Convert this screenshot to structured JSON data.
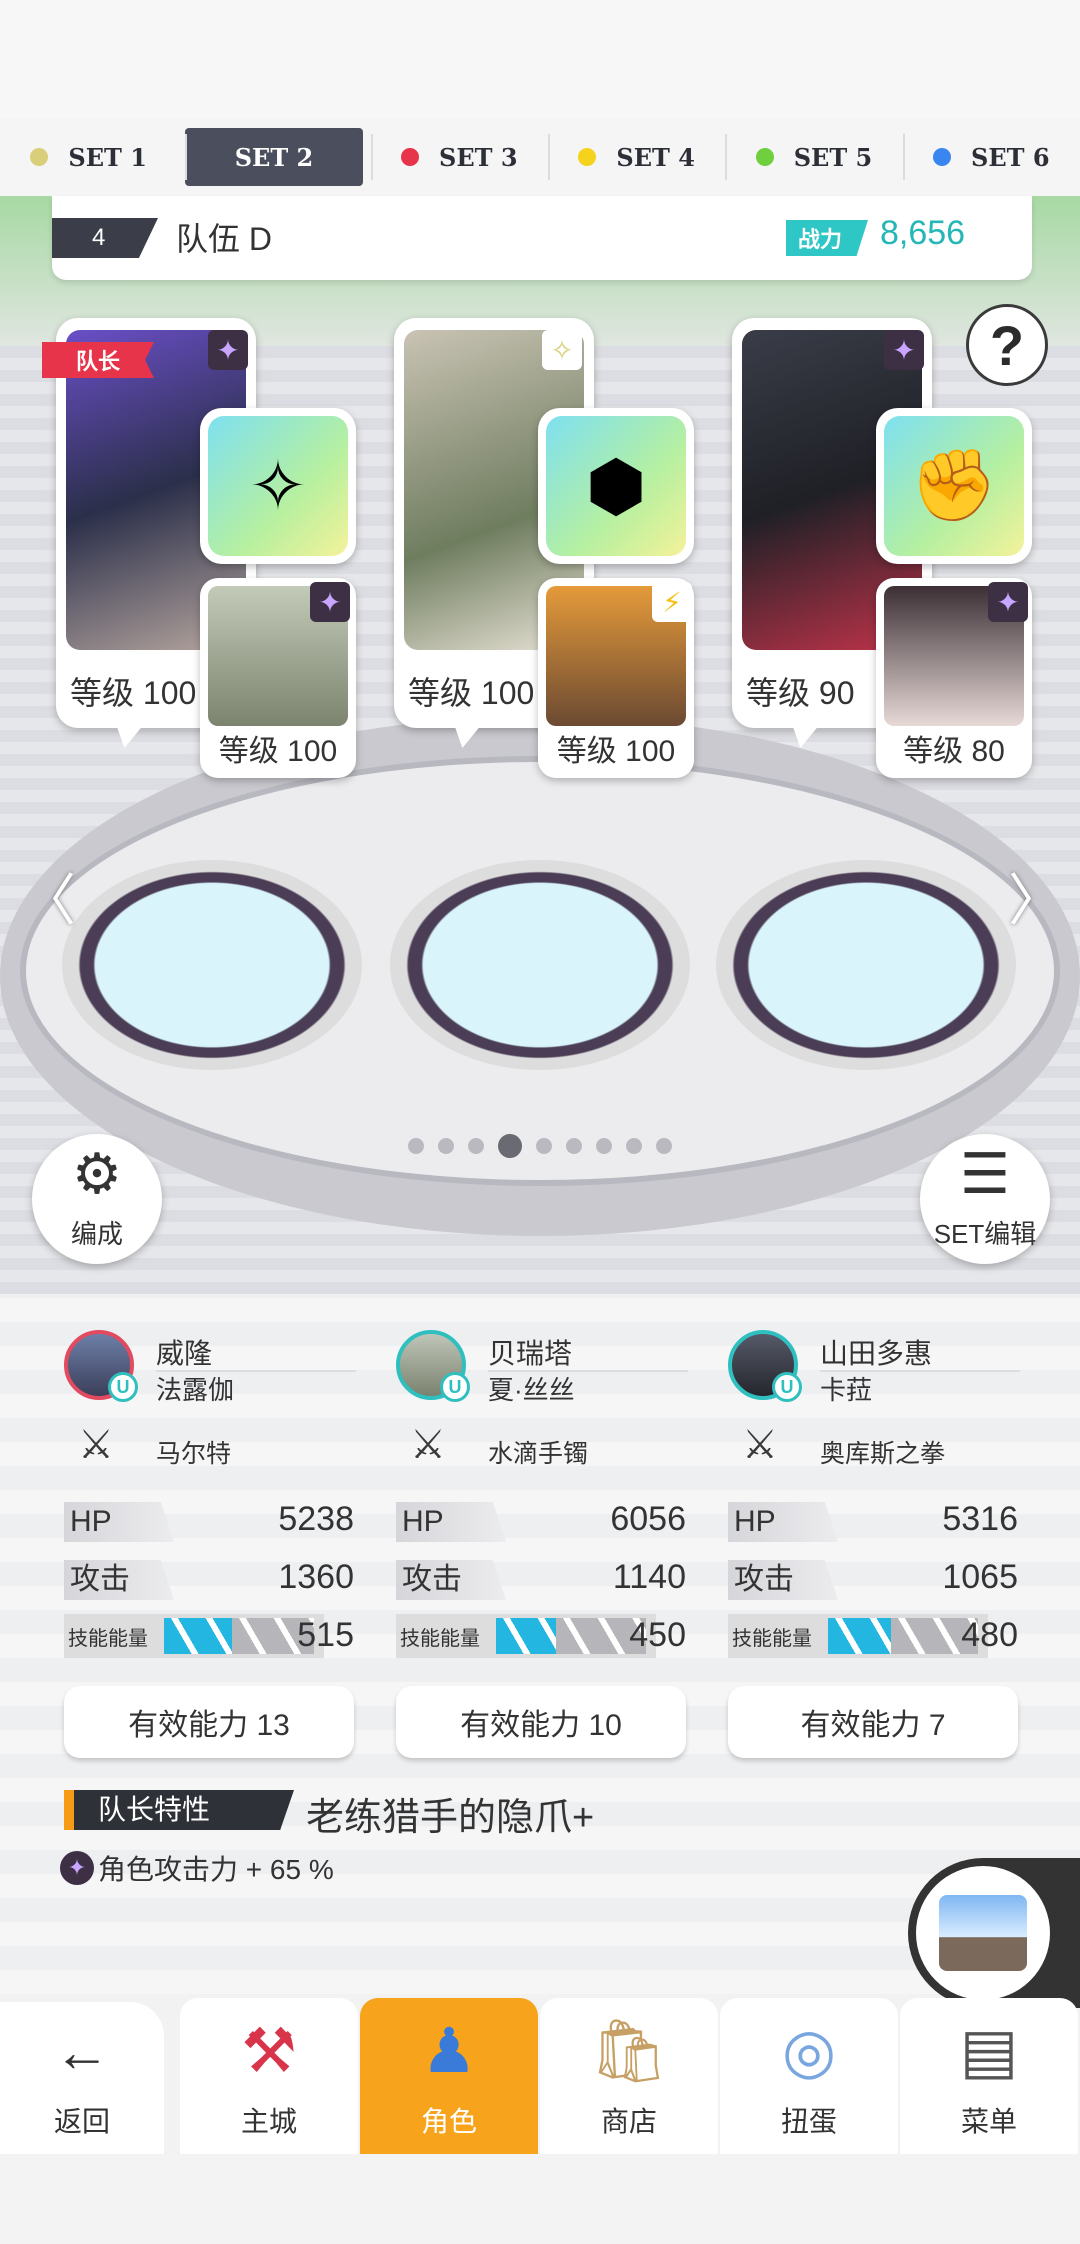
{
  "set_tabs": [
    {
      "label": "SET 1",
      "dot": "#d9cf7a"
    },
    {
      "label": "SET 2",
      "dot": ""
    },
    {
      "label": "SET 3",
      "dot": "#e8344a"
    },
    {
      "label": "SET 4",
      "dot": "#f5d21b"
    },
    {
      "label": "SET 5",
      "dot": "#6fcf3d"
    },
    {
      "label": "SET 6",
      "dot": "#3a86f0"
    }
  ],
  "team": {
    "number": "4",
    "name": "队伍 D",
    "power_label": "战力",
    "power": "8,656"
  },
  "leader_tag": "队长",
  "cards": [
    {
      "level": "等级 100",
      "sub_level": "等级 100"
    },
    {
      "level": "等级 100",
      "sub_level": "等级 100"
    },
    {
      "level": "等级 90",
      "sub_level": "等级 80"
    }
  ],
  "help": "?",
  "buttons": {
    "formation": "编成",
    "set_edit": "SET编辑"
  },
  "members": [
    {
      "name": "威隆",
      "support": "法露伽",
      "weapon": "马尔特",
      "hp": "5238",
      "atk": "1360",
      "energy": "515",
      "energy_fill": 0.45,
      "ability": "有效能力 13"
    },
    {
      "name": "贝瑞塔",
      "support": "夏·丝丝",
      "weapon": "水滴手镯",
      "hp": "6056",
      "atk": "1140",
      "energy": "450",
      "energy_fill": 0.4,
      "ability": "有效能力 10"
    },
    {
      "name": "山田多惠",
      "support": "卡菈",
      "weapon": "奥库斯之拳",
      "hp": "5316",
      "atk": "1065",
      "energy": "480",
      "energy_fill": 0.42,
      "ability": "有效能力 7"
    }
  ],
  "labels": {
    "hp": "HP",
    "atk": "攻击",
    "energy": "技能能量"
  },
  "leader_skill": {
    "label": "队长特性",
    "name": "老练猎手的隐爪+",
    "desc": "角色攻击力 + 65 %"
  },
  "nav": {
    "back": "返回",
    "items": [
      {
        "label": "主城",
        "icon": "castle-icon"
      },
      {
        "label": "角色",
        "icon": "character-icon"
      },
      {
        "label": "商店",
        "icon": "shop-icon"
      },
      {
        "label": "扭蛋",
        "icon": "gacha-icon"
      },
      {
        "label": "菜单",
        "icon": "menu-icon"
      }
    ]
  }
}
